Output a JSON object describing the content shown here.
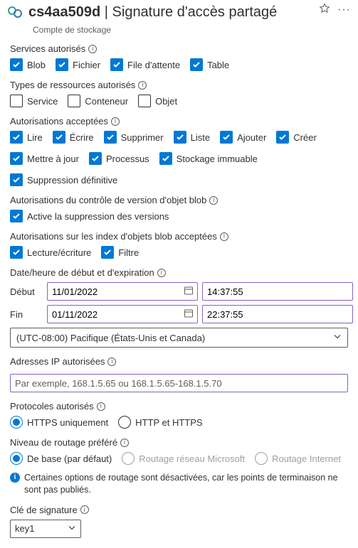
{
  "header": {
    "account": "cs4aa509d",
    "separator": "|",
    "page_title": "Signature d'accès partagé",
    "subtitle": "Compte de stockage"
  },
  "services": {
    "label": "Services autorisés",
    "blob": "Blob",
    "file": "Fichier",
    "queue": "File d'attente",
    "table": "Table"
  },
  "resource_types": {
    "label": "Types de ressources autorisés",
    "service": "Service",
    "container": "Conteneur",
    "object": "Objet"
  },
  "permissions": {
    "label": "Autorisations acceptées",
    "read": "Lire",
    "write": "Écrire",
    "delete": "Supprimer",
    "list": "Liste",
    "add": "Ajouter",
    "create": "Créer",
    "update": "Mettre à jour",
    "process": "Processus",
    "immutable": "Stockage immuable",
    "permdelete": "Suppression définitive"
  },
  "versioning": {
    "label": "Autorisations du contrôle de version d'objet blob",
    "enable": "Active la suppression des versions"
  },
  "index": {
    "label": "Autorisations sur les index d'objets blob acceptées",
    "rw": "Lecture/écriture",
    "filter": "Filtre"
  },
  "datetime": {
    "label": "Date/heure de début et d'expiration",
    "start_label": "Début",
    "end_label": "Fin",
    "start_date": "11/01/2022",
    "start_time": "14:37:55",
    "end_date": "01/11/2022",
    "end_time": "22:37:55",
    "timezone": "(UTC-08:00) Pacifique (États-Unis et Canada)"
  },
  "ip": {
    "label": "Adresses IP autorisées",
    "placeholder": "Par exemple, 168.1.5.65 ou 168.1.5.65-168.1.5.70"
  },
  "protocols": {
    "label": "Protocoles autorisés",
    "https": "HTTPS uniquement",
    "both": "HTTP et HTTPS"
  },
  "routing": {
    "label": "Niveau de routage préféré",
    "basic": "De base (par défaut)",
    "microsoft": "Routage réseau Microsoft",
    "internet": "Routage Internet",
    "note": "Certaines options de routage sont désactivées, car les points de terminaison ne sont pas publiés."
  },
  "key": {
    "label": "Clé de signature",
    "value": "key1"
  }
}
